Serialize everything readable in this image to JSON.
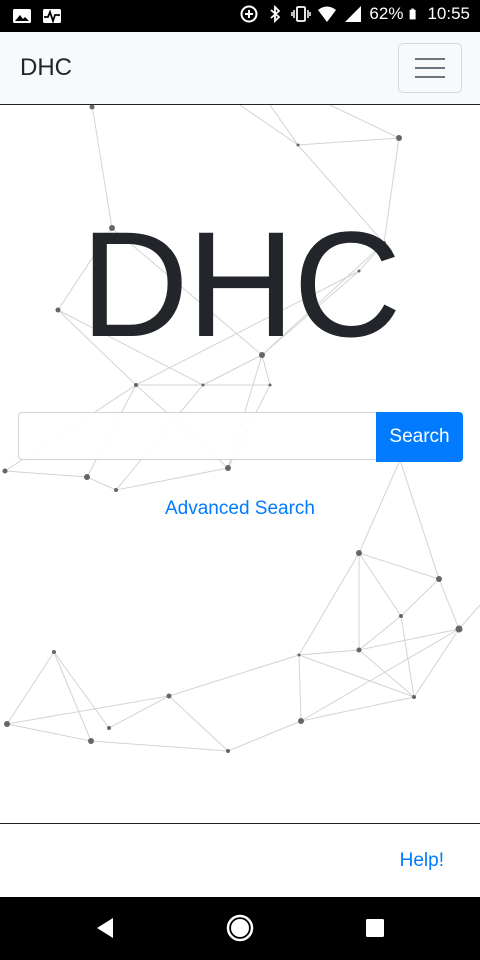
{
  "status_bar": {
    "battery": "62%",
    "time": "10:55",
    "icons": [
      "image-icon",
      "activity-icon",
      "data-saver-icon",
      "bluetooth-icon",
      "vibrate-icon",
      "wifi-icon",
      "signal-icon",
      "battery-icon"
    ]
  },
  "navbar": {
    "brand": "DHC",
    "menu_icon": "hamburger-menu-icon"
  },
  "main": {
    "title": "DHC",
    "search": {
      "placeholder": "",
      "value": "",
      "button_label": "Search"
    },
    "advanced_link": "Advanced Search"
  },
  "footer": {
    "help_link": "Help!"
  },
  "system_nav": {
    "icons": [
      "back-icon",
      "home-icon",
      "recents-icon"
    ]
  },
  "colors": {
    "accent": "#007bff",
    "navbar_bg": "#f8f9fa",
    "title_text": "#222529",
    "status_bar_bg": "#000000"
  }
}
